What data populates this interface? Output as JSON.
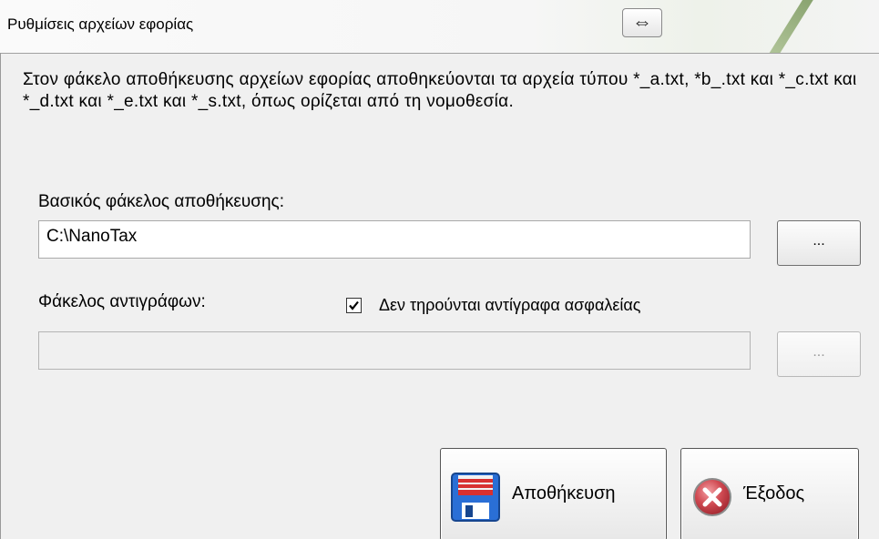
{
  "window": {
    "title": "Ρυθμίσεις αρχείων εφορίας",
    "resize_icon": "⇔"
  },
  "info": {
    "text": "Στον φάκελο αποθήκευσης αρχείων εφορίας αποθηκεύονται τα αρχεία τύπου *_a.txt, *b_.txt και *_c.txt και *_d.txt και *_e.txt και *_s.txt, όπως ορίζεται από τη νομοθεσία."
  },
  "base_folder": {
    "label": "Βασικός φάκελος αποθήκευσης:",
    "value": "C:\\NanoTax",
    "browse_label": "..."
  },
  "backup_folder": {
    "label": "Φάκελος αντιγράφων:",
    "value": "",
    "browse_label": "...",
    "no_backup_checkbox": {
      "label": "Δεν τηρούνται αντίγραφα ασφαλείας",
      "checked": true
    }
  },
  "actions": {
    "save_label": "Αποθήκευση",
    "exit_label": "Έξοδος"
  },
  "icons": {
    "save": "floppy-disk-icon",
    "exit": "red-x-circle-icon",
    "resize": "double-arrow-icon",
    "check": "checkmark-icon"
  },
  "colors": {
    "window_bg": "#f0f0f0",
    "floppy_blue": "#2a6fd6",
    "floppy_red": "#d83030",
    "exit_red": "#c0303a"
  }
}
